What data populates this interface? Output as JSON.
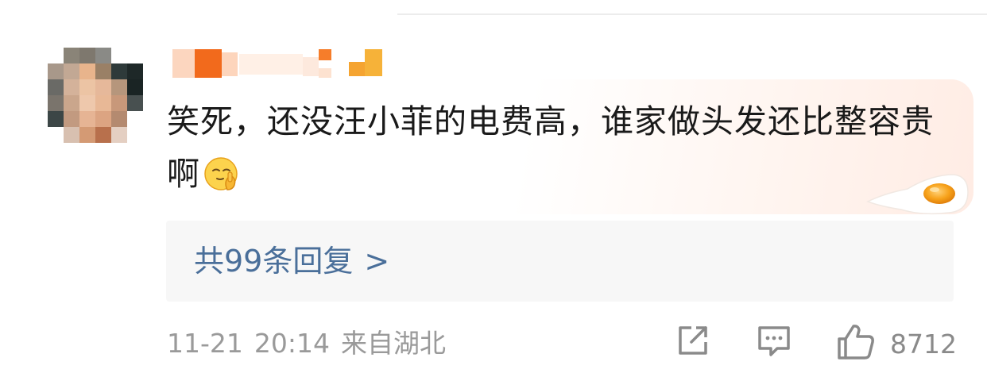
{
  "comment": {
    "text": "笑死，还没汪小菲的电费高，谁家做头发还比整容贵啊",
    "emoji": "shushing-face-emoji",
    "decoration": "fried-egg-sticker"
  },
  "replies": {
    "label": "共99条回复",
    "chevron": ">"
  },
  "meta": {
    "date": "11-21",
    "time": "20:14",
    "location": "来自湖北"
  },
  "actions": {
    "share_icon": "share-icon",
    "comment_icon": "comment-icon",
    "like_icon": "thumbs-up-icon",
    "like_count": "8712"
  },
  "colors": {
    "link": "#4a6f9a",
    "meta": "#9a9a9a",
    "text": "#1a1a1a",
    "replies_bg": "#f7f7f7"
  }
}
